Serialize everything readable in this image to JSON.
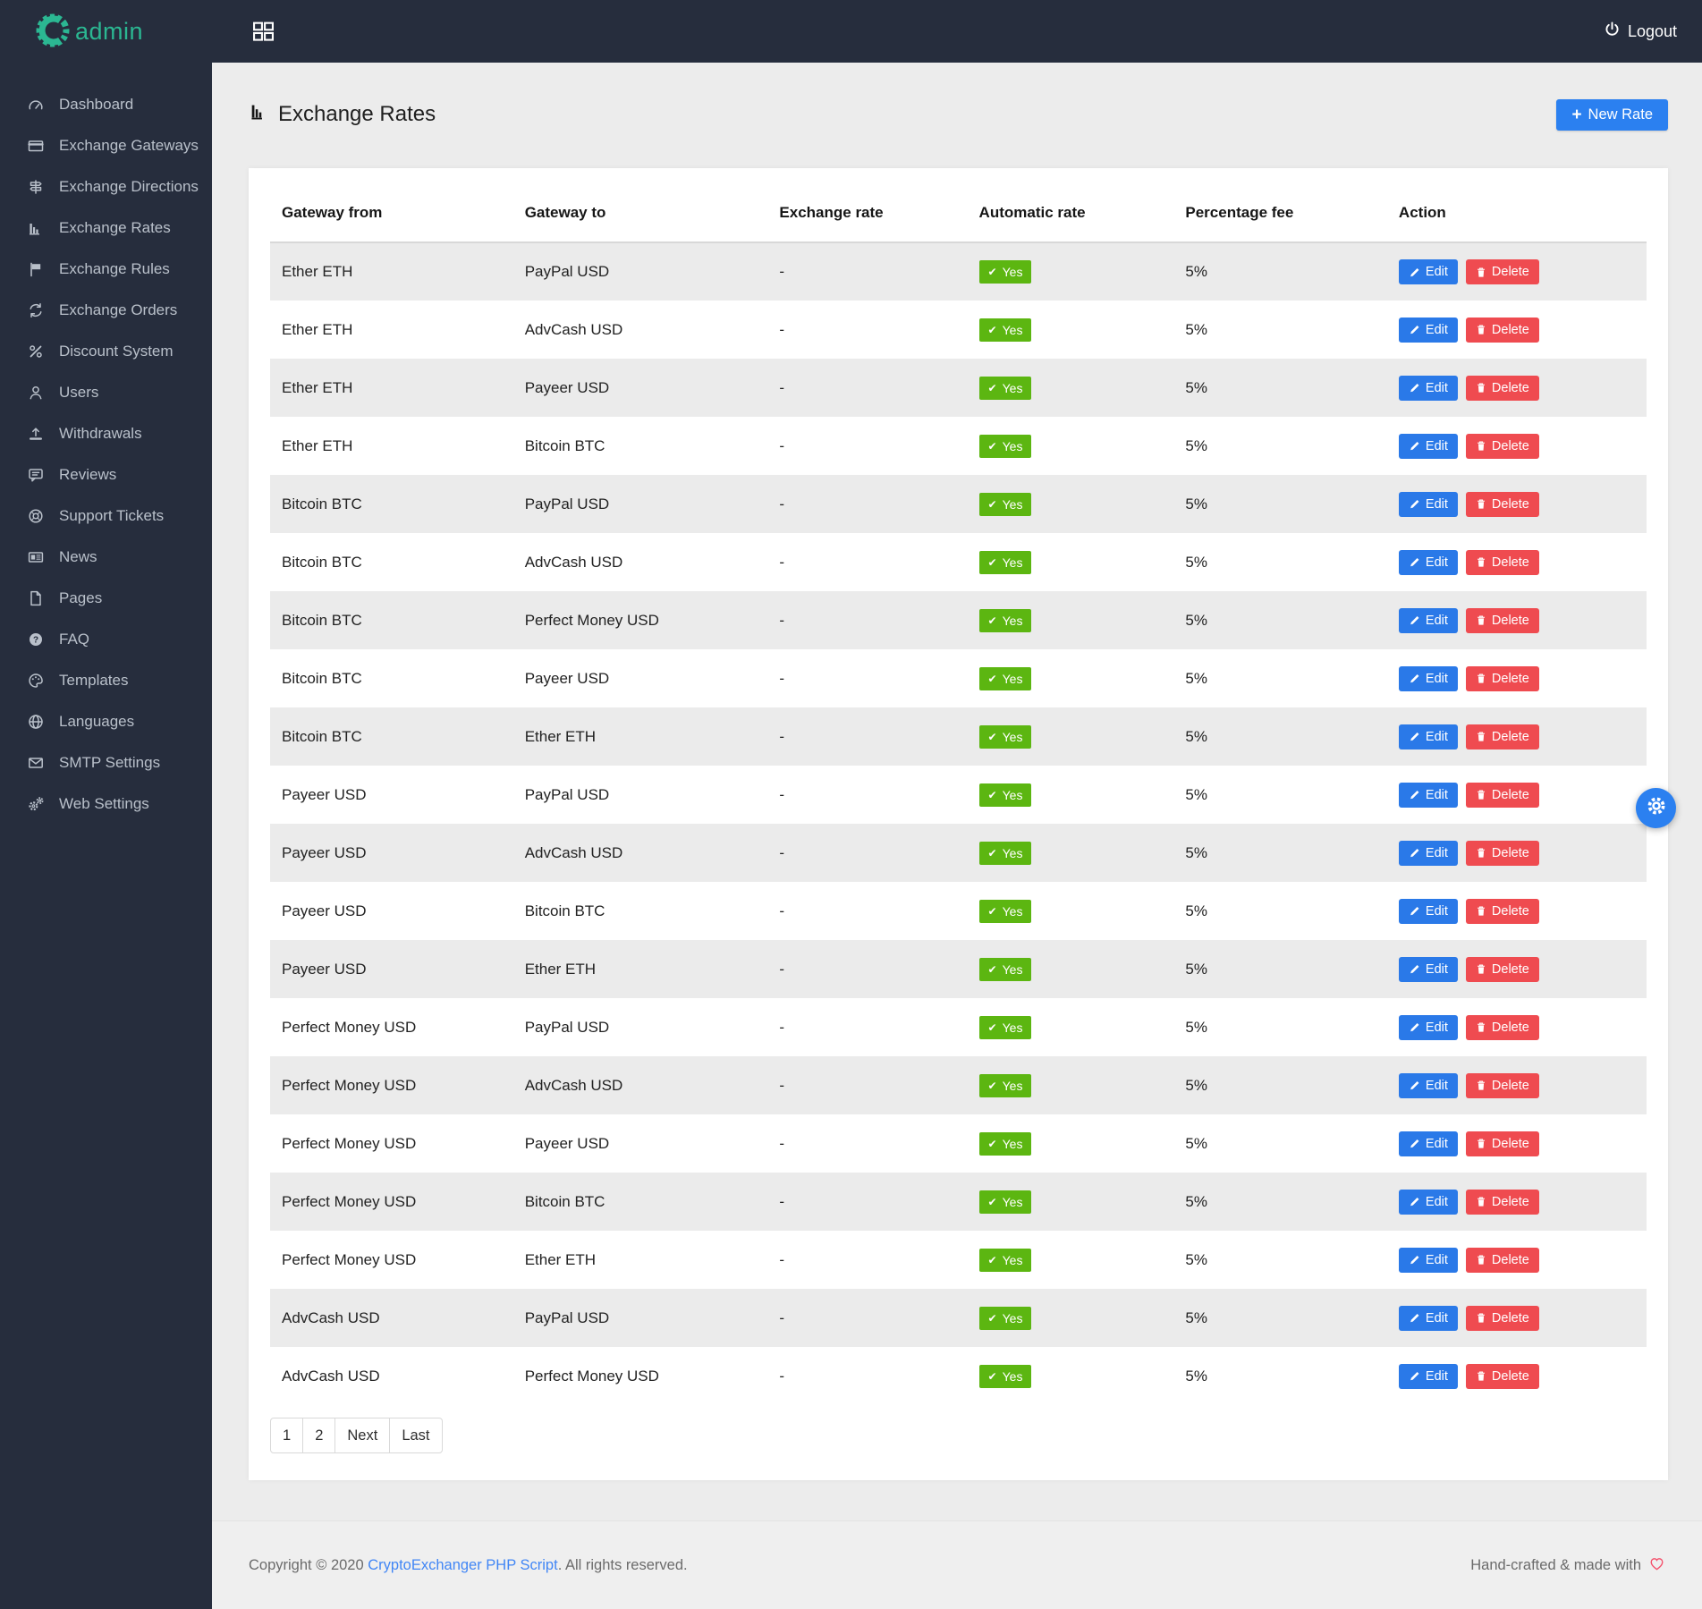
{
  "brand": {
    "name": "admin"
  },
  "topbar": {
    "logout_label": "Logout"
  },
  "sidebar": {
    "items": [
      {
        "label": "Dashboard",
        "icon": "dashboard-icon"
      },
      {
        "label": "Exchange Gateways",
        "icon": "credit-card-icon"
      },
      {
        "label": "Exchange Directions",
        "icon": "directions-icon"
      },
      {
        "label": "Exchange Rates",
        "icon": "chart-bar-icon"
      },
      {
        "label": "Exchange Rules",
        "icon": "flag-icon"
      },
      {
        "label": "Exchange Orders",
        "icon": "sync-icon"
      },
      {
        "label": "Discount System",
        "icon": "percent-icon"
      },
      {
        "label": "Users",
        "icon": "user-icon"
      },
      {
        "label": "Withdrawals",
        "icon": "upload-icon"
      },
      {
        "label": "Reviews",
        "icon": "comment-icon"
      },
      {
        "label": "Support Tickets",
        "icon": "life-ring-icon"
      },
      {
        "label": "News",
        "icon": "newspaper-icon"
      },
      {
        "label": "Pages",
        "icon": "file-icon"
      },
      {
        "label": "FAQ",
        "icon": "question-circle-icon"
      },
      {
        "label": "Templates",
        "icon": "palette-icon"
      },
      {
        "label": "Languages",
        "icon": "globe-icon"
      },
      {
        "label": "SMTP Settings",
        "icon": "envelope-icon"
      },
      {
        "label": "Web Settings",
        "icon": "cogs-icon"
      }
    ]
  },
  "page": {
    "title": "Exchange Rates",
    "new_rate_label": "New Rate"
  },
  "table": {
    "columns": [
      "Gateway from",
      "Gateway to",
      "Exchange rate",
      "Automatic rate",
      "Percentage fee",
      "Action"
    ],
    "edit_label": "Edit",
    "delete_label": "Delete",
    "rows": [
      {
        "from": "Ether ETH",
        "to": "PayPal USD",
        "rate": "-",
        "automatic": "Yes",
        "fee": "5%"
      },
      {
        "from": "Ether ETH",
        "to": "AdvCash USD",
        "rate": "-",
        "automatic": "Yes",
        "fee": "5%"
      },
      {
        "from": "Ether ETH",
        "to": "Payeer USD",
        "rate": "-",
        "automatic": "Yes",
        "fee": "5%"
      },
      {
        "from": "Ether ETH",
        "to": "Bitcoin BTC",
        "rate": "-",
        "automatic": "Yes",
        "fee": "5%"
      },
      {
        "from": "Bitcoin BTC",
        "to": "PayPal USD",
        "rate": "-",
        "automatic": "Yes",
        "fee": "5%"
      },
      {
        "from": "Bitcoin BTC",
        "to": "AdvCash USD",
        "rate": "-",
        "automatic": "Yes",
        "fee": "5%"
      },
      {
        "from": "Bitcoin BTC",
        "to": "Perfect Money USD",
        "rate": "-",
        "automatic": "Yes",
        "fee": "5%"
      },
      {
        "from": "Bitcoin BTC",
        "to": "Payeer USD",
        "rate": "-",
        "automatic": "Yes",
        "fee": "5%"
      },
      {
        "from": "Bitcoin BTC",
        "to": "Ether ETH",
        "rate": "-",
        "automatic": "Yes",
        "fee": "5%"
      },
      {
        "from": "Payeer USD",
        "to": "PayPal USD",
        "rate": "-",
        "automatic": "Yes",
        "fee": "5%"
      },
      {
        "from": "Payeer USD",
        "to": "AdvCash USD",
        "rate": "-",
        "automatic": "Yes",
        "fee": "5%"
      },
      {
        "from": "Payeer USD",
        "to": "Bitcoin BTC",
        "rate": "-",
        "automatic": "Yes",
        "fee": "5%"
      },
      {
        "from": "Payeer USD",
        "to": "Ether ETH",
        "rate": "-",
        "automatic": "Yes",
        "fee": "5%"
      },
      {
        "from": "Perfect Money USD",
        "to": "PayPal USD",
        "rate": "-",
        "automatic": "Yes",
        "fee": "5%"
      },
      {
        "from": "Perfect Money USD",
        "to": "AdvCash USD",
        "rate": "-",
        "automatic": "Yes",
        "fee": "5%"
      },
      {
        "from": "Perfect Money USD",
        "to": "Payeer USD",
        "rate": "-",
        "automatic": "Yes",
        "fee": "5%"
      },
      {
        "from": "Perfect Money USD",
        "to": "Bitcoin BTC",
        "rate": "-",
        "automatic": "Yes",
        "fee": "5%"
      },
      {
        "from": "Perfect Money USD",
        "to": "Ether ETH",
        "rate": "-",
        "automatic": "Yes",
        "fee": "5%"
      },
      {
        "from": "AdvCash USD",
        "to": "PayPal USD",
        "rate": "-",
        "automatic": "Yes",
        "fee": "5%"
      },
      {
        "from": "AdvCash USD",
        "to": "Perfect Money USD",
        "rate": "-",
        "automatic": "Yes",
        "fee": "5%"
      }
    ]
  },
  "pagination": {
    "items": [
      "1",
      "2",
      "Next",
      "Last"
    ]
  },
  "footer": {
    "copyright_prefix": "Copyright © 2020 ",
    "link_text": "CryptoExchanger PHP Script",
    "copyright_suffix": ". All rights reserved.",
    "right_text": "Hand-crafted & made with"
  },
  "colors": {
    "sidebar_bg": "#262d3d",
    "brand_teal": "#2bb792",
    "primary_blue": "#2b80f0",
    "edit_blue": "#2a79e8",
    "delete_red": "#ef4b50",
    "success_green": "#5cb611",
    "stripe_gray": "#ebebeb",
    "page_bg": "#ececec",
    "heart_pink": "#f4516c"
  }
}
